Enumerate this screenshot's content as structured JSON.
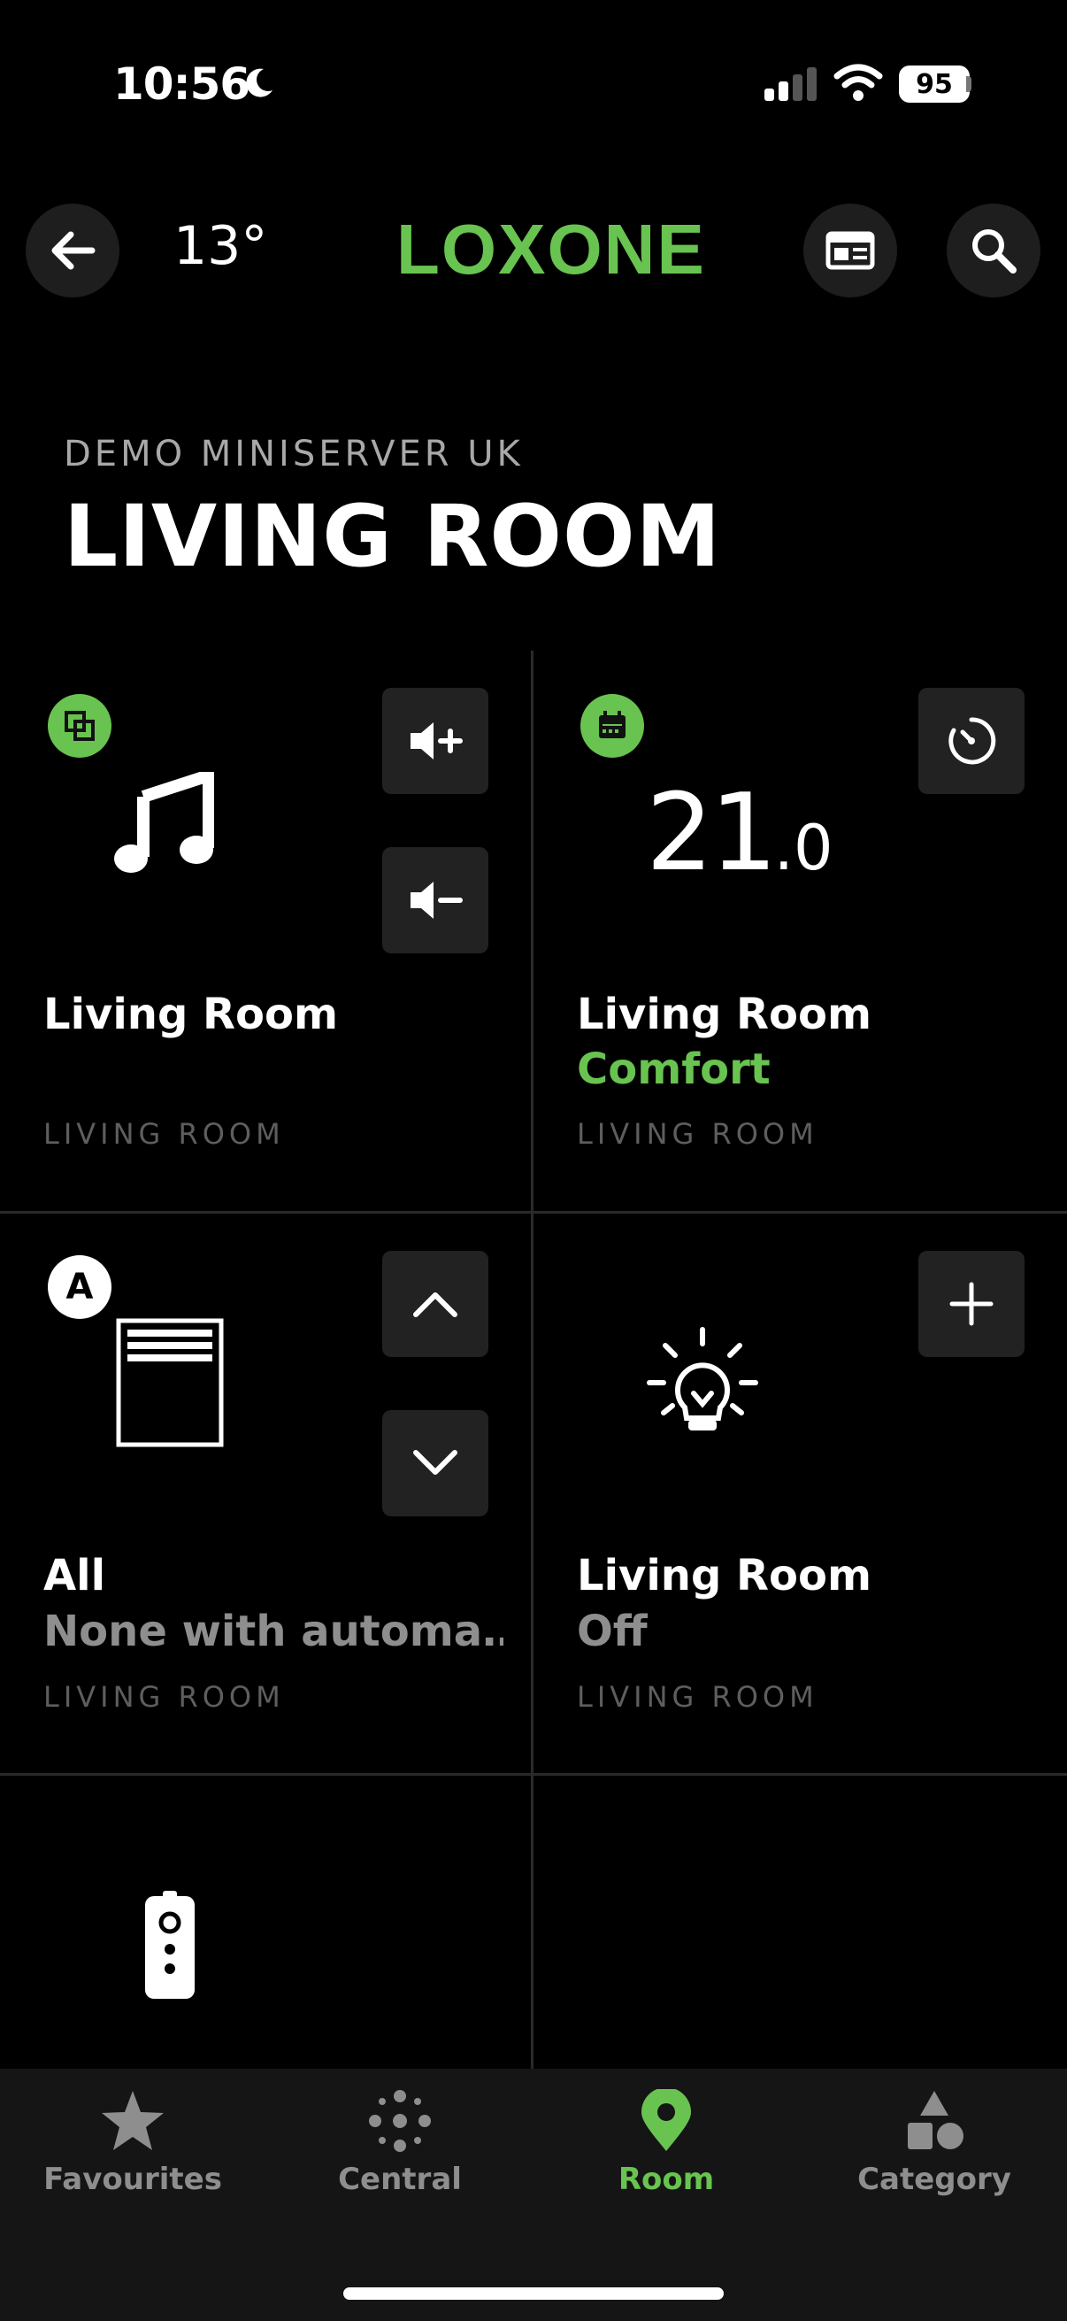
{
  "status": {
    "time": "10:56",
    "battery": "95"
  },
  "header": {
    "temperature": "13°",
    "logo": "LOXONE"
  },
  "page": {
    "server": "DEMO MINISERVER UK",
    "title": "LIVING ROOM"
  },
  "tiles": [
    {
      "name": "Living Room",
      "subtitle": "",
      "room": "LIVING ROOM"
    },
    {
      "name": "Living Room",
      "subtitle": "Comfort",
      "room": "LIVING ROOM",
      "temp_main": "21",
      "temp_decimal": ".0"
    },
    {
      "name": "All",
      "subtitle": "None with automa…",
      "room": "LIVING ROOM",
      "badge": "A"
    },
    {
      "name": "Living Room",
      "subtitle": "Off",
      "room": "LIVING ROOM"
    }
  ],
  "tabs": [
    {
      "label": "Favourites"
    },
    {
      "label": "Central"
    },
    {
      "label": "Room"
    },
    {
      "label": "Category"
    }
  ],
  "colors": {
    "accent": "#69c350",
    "tile_button": "#222222",
    "muted": "#8e8e8e"
  }
}
